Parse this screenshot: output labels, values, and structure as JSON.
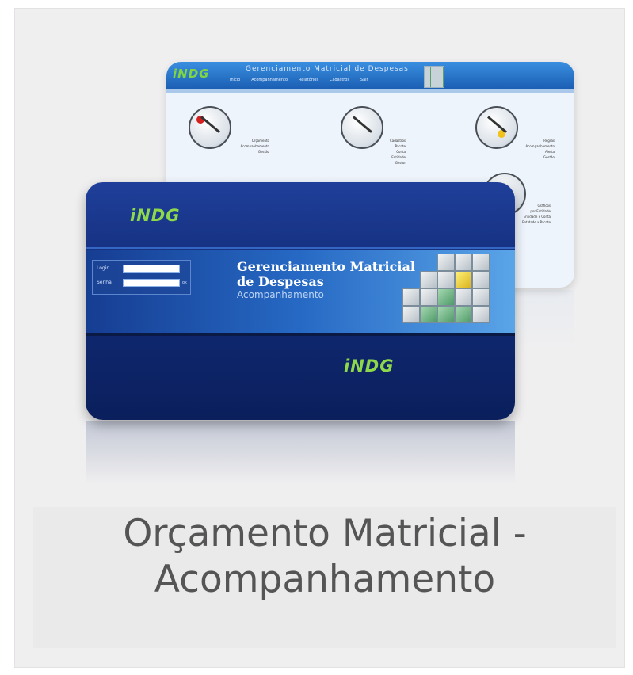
{
  "caption": {
    "line1": "Orçamento Matricial -",
    "line2": "Acompanhamento"
  },
  "back_screen": {
    "logo": "iNDG",
    "title": "Gerenciamento Matricial de Despesas",
    "menu": [
      "Início",
      "Acompanhamento",
      "Relatórios",
      "Cadastros",
      "Sair"
    ],
    "items": [
      {
        "label": "Orçamento",
        "links": [
          "Acompanhamento",
          "Gestão"
        ],
        "dot": "#d32020"
      },
      {
        "label": "Cadastros",
        "links": [
          "Pacote",
          "Conta",
          "Entidade",
          "Gestor"
        ],
        "dot": "#ffffff"
      },
      {
        "label": "Regras",
        "links": [
          "Acompanhamento",
          "Alerta",
          "Gestão"
        ],
        "dot": "#f2c21b"
      }
    ],
    "lower_links": [
      "Gráficos",
      "por Entidade",
      "Entidade x Conta",
      "Entidade x Pacote"
    ]
  },
  "front_screen": {
    "logo_top": "iNDG",
    "logo_bottom": "iNDG",
    "login_label": "Login",
    "password_label": "Senha",
    "ok_label": "ok",
    "title_line1": "Gerenciamento Matricial",
    "title_line2": "de Despesas",
    "subtitle": "Acompanhamento"
  },
  "colors": {
    "front_bg": "#122c79",
    "logo_green": "#8ed94a",
    "back_header": "#1b5fb4",
    "caption_text": "#555555",
    "card_bg": "#f0eff0"
  }
}
